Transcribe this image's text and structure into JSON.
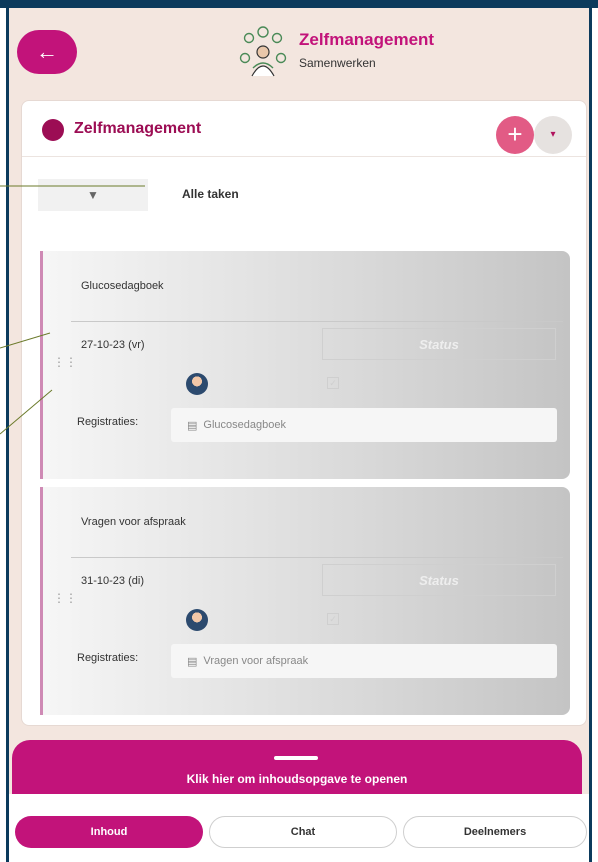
{
  "header": {
    "title": "Zelfmanagement",
    "subtitle": "Samenwerken",
    "icon": "people-network-icon"
  },
  "card": {
    "title": "Zelfmanagement",
    "add_icon": "+",
    "dropdown_icon": "▾",
    "filter_icon": "▼",
    "filter_label": "Alle taken"
  },
  "tasks": [
    {
      "title": "Glucosedagboek",
      "date": "27-10-23 (vr)",
      "status_placeholder": "Status",
      "registrations_label": "Registraties:",
      "registration": "Glucosedagboek"
    },
    {
      "title": "Vragen voor afspraak",
      "date": "31-10-23 (di)",
      "status_placeholder": "Status",
      "registrations_label": "Registraties:",
      "registration": "Vragen voor afspraak"
    }
  ],
  "toc": {
    "text": "Klik hier om inhoudsopgave te openen"
  },
  "nav": {
    "inhoud": "Inhoud",
    "chat": "Chat",
    "deelnemers": "Deelnemers"
  },
  "colors": {
    "accent": "#c2137a",
    "dark_blue": "#0b3a5c",
    "task_border": "#cf8ab5"
  }
}
